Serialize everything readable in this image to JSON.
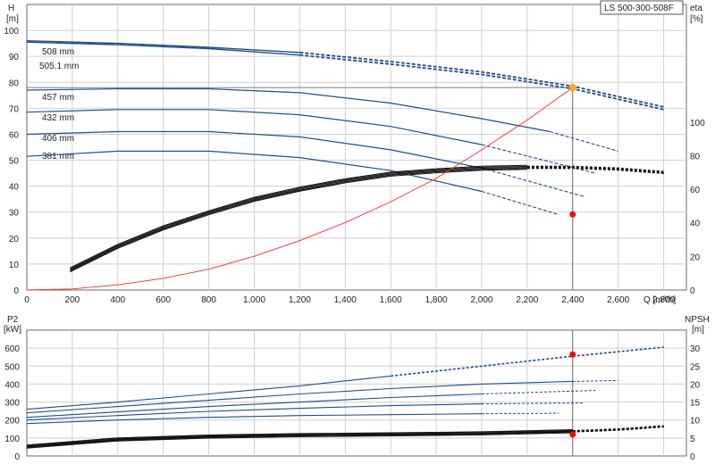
{
  "colors": {
    "curve": "#1f4e8c",
    "eta": "#111111",
    "system": "#ff2a2a",
    "duty": "#ff0000",
    "duty_top": "#ffb000",
    "grid": "#cfcfcf"
  },
  "chart_data": [
    {
      "type": "line",
      "panel": "head",
      "title_box": "LS 500-300-508F",
      "ylabel_left": [
        "H",
        "[m]"
      ],
      "ylabel_right": [
        "eta",
        "[%]"
      ],
      "xlabel": "Q [m³/h]",
      "xlim": [
        0,
        2900
      ],
      "ylim": [
        0,
        110
      ],
      "right_ylim": [
        0,
        170
      ],
      "x_ticks": [
        "0",
        "200",
        "400",
        "600",
        "800",
        "1,000",
        "1,200",
        "1,400",
        "1,600",
        "1,800",
        "2,000",
        "2,200",
        "2,400",
        "2,600",
        "2,800"
      ],
      "x_tick_values": [
        0,
        200,
        400,
        600,
        800,
        1000,
        1200,
        1400,
        1600,
        1800,
        2000,
        2200,
        2400,
        2600,
        2800
      ],
      "y_ticks": [
        "0",
        "10",
        "20",
        "30",
        "40",
        "50",
        "60",
        "70",
        "80",
        "90",
        "100"
      ],
      "y_tick_values": [
        0,
        10,
        20,
        30,
        40,
        50,
        60,
        70,
        80,
        90,
        100
      ],
      "right_ticks": [
        "0",
        "20",
        "40",
        "60",
        "80",
        "100"
      ],
      "right_tick_values": [
        0,
        20,
        40,
        60,
        80,
        100
      ],
      "grid": true,
      "head_series": [
        {
          "name": "508 mm",
          "x": [
            0,
            400,
            800,
            1200,
            1600,
            2000,
            2400,
            2800
          ],
          "y": [
            96,
            95,
            93.5,
            91.5,
            88,
            84,
            78.5,
            70.5
          ]
        },
        {
          "name": "505.1 mm",
          "x": [
            0,
            400,
            800,
            1200,
            1600,
            2000,
            2400,
            2800
          ],
          "y": [
            95.5,
            94.5,
            93,
            90.5,
            87,
            83,
            77.5,
            69.5
          ]
        },
        {
          "name": "457 mm",
          "x": [
            0,
            400,
            800,
            1200,
            1600,
            2000,
            2300,
            2600
          ],
          "y": [
            77,
            77.5,
            77.5,
            76,
            72,
            66,
            61,
            53.5
          ]
        },
        {
          "name": "432 mm",
          "x": [
            0,
            400,
            800,
            1200,
            1600,
            2000,
            2500
          ],
          "y": [
            68.5,
            69.5,
            69.5,
            67.5,
            63,
            56,
            45
          ]
        },
        {
          "name": "406 mm",
          "x": [
            0,
            400,
            800,
            1200,
            1600,
            2000,
            2450
          ],
          "y": [
            60,
            61,
            61,
            59,
            54,
            47,
            36
          ]
        },
        {
          "name": "381 mm",
          "x": [
            0,
            400,
            800,
            1200,
            1600,
            2000,
            2340
          ],
          "y": [
            51.5,
            53.5,
            53.5,
            51,
            46,
            38,
            29
          ]
        }
      ],
      "eta_series": {
        "x": [
          190,
          400,
          600,
          800,
          1000,
          1200,
          1400,
          1600,
          1800,
          2000,
          2200,
          2400,
          2600,
          2800
        ],
        "y": [
          12,
          26,
          37,
          46,
          54,
          60,
          65,
          69,
          71,
          72.5,
          73,
          73,
          72,
          70
        ]
      },
      "system_curve": {
        "x": [
          0,
          200,
          400,
          600,
          800,
          1000,
          1200,
          1400,
          1600,
          1800,
          2000,
          2200,
          2400
        ],
        "y": [
          0,
          0.4,
          2,
          4.5,
          8,
          13,
          19,
          26,
          34,
          43,
          54,
          65.5,
          78
        ]
      },
      "duty_point": {
        "q": 2400,
        "h": 78,
        "eta": 45
      }
    },
    {
      "type": "line",
      "panel": "power_npsh",
      "ylabel_left": [
        "P2",
        "[kW]"
      ],
      "ylabel_right": [
        "NPSH",
        "[m]"
      ],
      "xlim": [
        0,
        2900
      ],
      "ylim": [
        0,
        700
      ],
      "right_ylim": [
        0,
        35
      ],
      "y_ticks": [
        "0",
        "100",
        "200",
        "300",
        "400",
        "500",
        "600"
      ],
      "y_tick_values": [
        0,
        100,
        200,
        300,
        400,
        500,
        600
      ],
      "right_ticks": [
        "0",
        "5",
        "10",
        "15",
        "20",
        "25",
        "30"
      ],
      "right_tick_values": [
        0,
        5,
        10,
        15,
        20,
        25,
        30
      ],
      "grid": true,
      "power_series": [
        {
          "x": [
            0,
            400,
            800,
            1200,
            1600,
            2000,
            2400,
            2800
          ],
          "y": [
            260,
            300,
            345,
            390,
            445,
            500,
            555,
            605
          ]
        },
        {
          "x": [
            0,
            400,
            800,
            1200,
            1600,
            2000,
            2400,
            2600
          ],
          "y": [
            240,
            275,
            310,
            345,
            375,
            400,
            415,
            420
          ]
        },
        {
          "x": [
            0,
            400,
            800,
            1200,
            1600,
            2000,
            2500
          ],
          "y": [
            215,
            245,
            275,
            300,
            325,
            345,
            365
          ]
        },
        {
          "x": [
            0,
            400,
            800,
            1200,
            1600,
            2000,
            2450
          ],
          "y": [
            200,
            225,
            248,
            265,
            280,
            290,
            295
          ]
        },
        {
          "x": [
            0,
            400,
            800,
            1200,
            1600,
            2000,
            2340
          ],
          "y": [
            180,
            200,
            215,
            225,
            230,
            235,
            238
          ]
        }
      ],
      "npsh_series": {
        "x": [
          0,
          400,
          800,
          1200,
          1600,
          2000,
          2400,
          2600,
          2800
        ],
        "y": [
          2.5,
          4.5,
          5.3,
          5.7,
          5.9,
          6.2,
          6.8,
          7.3,
          8.2
        ]
      },
      "duty_point": {
        "q": 2400,
        "p2": 565,
        "npsh": 6
      }
    }
  ]
}
